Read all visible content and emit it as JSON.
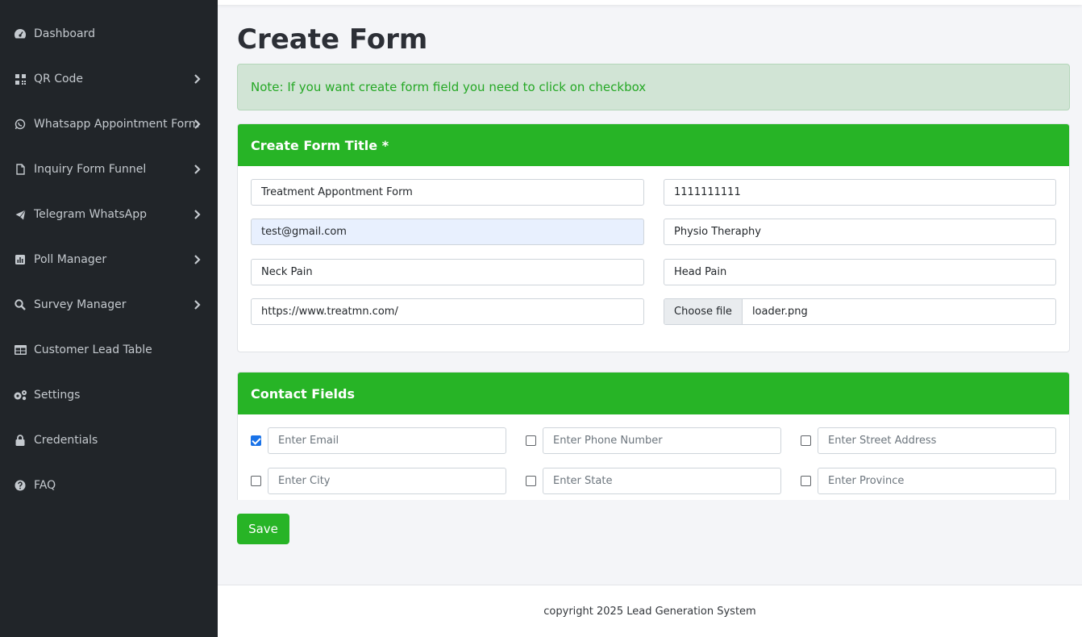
{
  "sidebar": {
    "items": [
      {
        "label": "Dashboard",
        "icon": "dashboard-icon"
      },
      {
        "label": "QR Code",
        "icon": "qrcode-icon"
      },
      {
        "label": "Whatsapp Appointment Form",
        "icon": "whatsapp-icon"
      },
      {
        "label": "Inquiry Form Funnel",
        "icon": "file-icon"
      },
      {
        "label": "Telegram WhatsApp",
        "icon": "telegram-icon"
      },
      {
        "label": "Poll Manager",
        "icon": "poll-icon"
      },
      {
        "label": "Survey Manager",
        "icon": "search-icon"
      },
      {
        "label": "Customer Lead Table",
        "icon": "table-icon"
      },
      {
        "label": "Settings",
        "icon": "gears-icon"
      },
      {
        "label": "Credentials",
        "icon": "lock-icon"
      },
      {
        "label": "FAQ",
        "icon": "question-icon"
      }
    ]
  },
  "page": {
    "title": "Create Form",
    "note": "Note: If you want create form field you need to click on checkbox"
  },
  "form_title_card": {
    "header": "Create Form Title *",
    "fields": {
      "title": "Treatment Appontment Form",
      "phone": "1111111111",
      "email": "test@gmail.com",
      "category": "Physio Theraphy",
      "option1": "Neck Pain",
      "option2": "Head Pain",
      "url": "https://www.treatmn.com/",
      "file_button": "Choose file",
      "file_name": "loader.png"
    }
  },
  "contact_card": {
    "header": "Contact Fields",
    "fields": [
      {
        "placeholder": "Enter Email",
        "checked": true
      },
      {
        "placeholder": "Enter Phone Number",
        "checked": false
      },
      {
        "placeholder": "Enter Street Address",
        "checked": false
      },
      {
        "placeholder": "Enter City",
        "checked": false
      },
      {
        "placeholder": "Enter State",
        "checked": false
      },
      {
        "placeholder": "Enter Province",
        "checked": false
      }
    ]
  },
  "save_label": "Save",
  "footer": "copyright 2025 Lead Generation System",
  "colors": {
    "sidebar_bg": "#212529",
    "accent_green": "#27b426",
    "alert_bg": "#d1e4d5",
    "alert_text": "#25a825"
  }
}
